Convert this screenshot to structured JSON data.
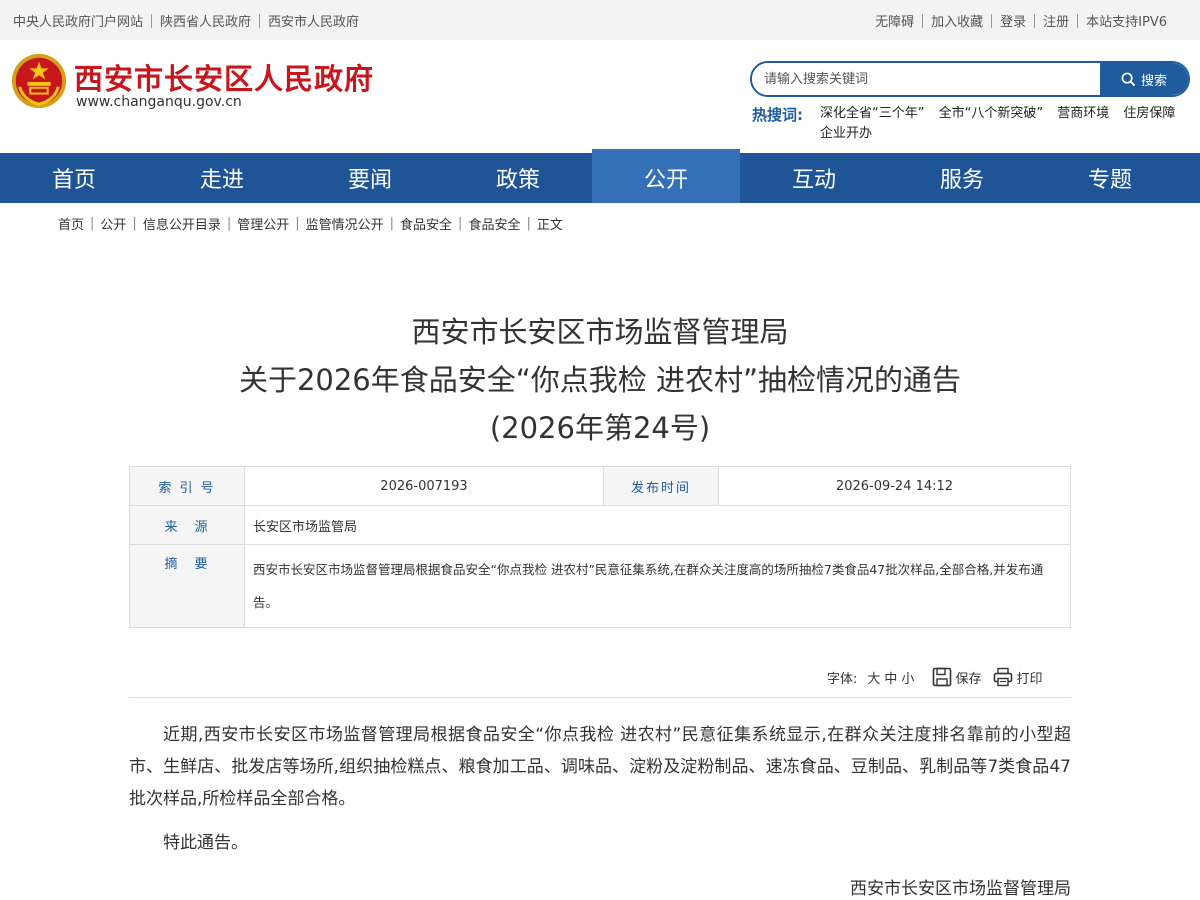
{
  "topbar": {
    "left_links": [
      "中央人民政府门户网站",
      "陕西省人民政府",
      "西安市人民政府"
    ],
    "right_links": [
      "无障碍",
      "加入收藏",
      "登录",
      "注册",
      "本站支持IPV6"
    ]
  },
  "header": {
    "site_title": "西安市长安区人民政府",
    "site_url": "www.changanqu.gov.cn",
    "search_placeholder": "请输入搜索关键词",
    "search_button": "搜索",
    "hot_label": "热搜词:",
    "hot_words": [
      "深化全省“三个年”",
      "全市“八个新突破”",
      "营商环境",
      "住房保障",
      "企业开办"
    ]
  },
  "nav": {
    "items": [
      "首页",
      "走进",
      "要闻",
      "政策",
      "公开",
      "互动",
      "服务",
      "专题"
    ],
    "active": "公开"
  },
  "breadcrumb": [
    "首页",
    "公开",
    "信息公开目录",
    "管理公开",
    "监管情况公开",
    "食品安全",
    "食品安全",
    "正文"
  ],
  "article": {
    "title_lines": [
      "西安市长安区市场监督管理局",
      "关于2026年食品安全“你点我检 进农村”抽检情况的通告",
      "(2026年第24号)"
    ],
    "meta": {
      "index_label": "索 引 号",
      "index_value": "2026-007193",
      "date_label": "发布时间",
      "date_value": "2026-09-24 14:12",
      "source_label": "来　源",
      "source_value": "长安区市场监管局",
      "summary_label": "摘　要",
      "summary_value": "西安市长安区市场监督管理局根据食品安全“你点我检 进农村”民意征集系统,在群众关注度高的场所抽检7类食品47批次样品,全部合格,并发布通告。"
    },
    "tools": {
      "font_label": "字体:",
      "size_large": "大",
      "size_medium": "中",
      "size_small": "小",
      "save": "保存",
      "print": "打印"
    },
    "paragraphs": [
      "近期,西安市长安区市场监督管理局根据食品安全“你点我检 进农村”民意征集系统显示,在群众关注度排名靠前的小型超市、生鲜店、批发店等场所,组织抽检糕点、粮食加工品、调味品、淀粉及淀粉制品、速冻食品、豆制品、乳制品等7类食品47批次样品,所检样品全部合格。",
      "特此通告。"
    ],
    "signature": "西安市长安区市场监督管理局"
  },
  "colors": {
    "brand_red": "#c8161d",
    "nav_blue": "#1f5596",
    "nav_active": "#3470b8",
    "link_blue": "#1f5c9e"
  }
}
